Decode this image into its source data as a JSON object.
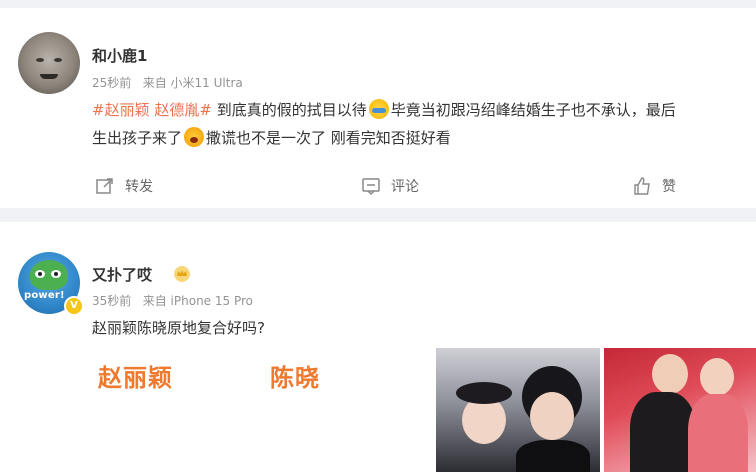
{
  "posts": [
    {
      "username": "和小鹿1",
      "time": "25秒前",
      "source": "来自 小米11 Ultra",
      "content": {
        "topic1": "#赵丽颖",
        "topic2": "赵德胤#",
        "text1": " 到底真的假的拭目以待",
        "text2": "毕竟当初跟冯绍峰结婚生子也不承认，最后",
        "text3": "生出孩子来了",
        "text4": "撒谎也不是一次了 刚看完知否挺好看"
      },
      "emojis": [
        "sweat-emoji",
        "crying-emoji"
      ],
      "actions": {
        "repost": "转发",
        "comment": "评论",
        "like": "赞"
      }
    },
    {
      "username": "又扑了哎",
      "avatar_text": "power!",
      "time": "35秒前",
      "source": "来自 iPhone 15 Pro",
      "content": "赵丽颖陈晓原地复合好吗?",
      "images": [
        {
          "label": "赵丽颖"
        },
        {
          "label": "陈晓"
        },
        {
          "label": ""
        },
        {
          "label": ""
        }
      ]
    }
  ],
  "colors": {
    "topic": "#eb7350",
    "meta": "#939393",
    "background": "#f1f2f5"
  }
}
